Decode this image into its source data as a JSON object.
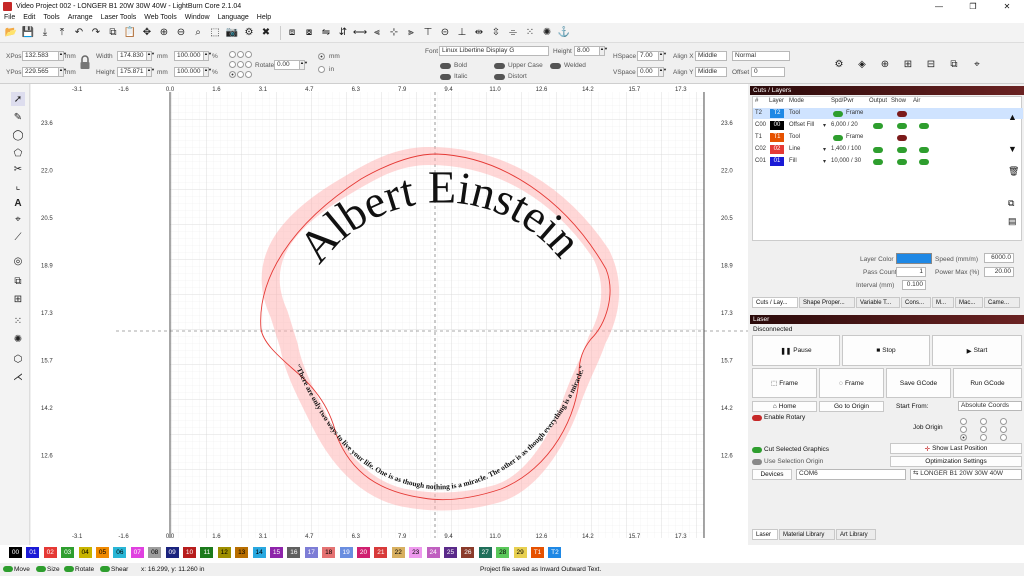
{
  "window": {
    "title": "Video Project 002 - LONGER B1 20W 30W 40W - LightBurn Core 2.1.04",
    "minimize": "—",
    "maximize": "❐",
    "close": "✕"
  },
  "menu": [
    "File",
    "Edit",
    "Tools",
    "Arrange",
    "Laser Tools",
    "Web Tools",
    "Window",
    "Language",
    "Help"
  ],
  "toolbar": {
    "icons": [
      "open-file-icon",
      "save-icon",
      "import-icon",
      "export-icon",
      "undo-icon",
      "redo-icon",
      "copy-icon",
      "paste-icon",
      "move-icon",
      "zoom-in-icon",
      "zoom-out-icon",
      "zoom-frame-icon",
      "select-frame-icon",
      "camera-icon",
      "settings-icon",
      "tools-icon"
    ],
    "icons2": [
      "group-icon",
      "ungroup-icon",
      "flip-h-icon",
      "flip-v-icon",
      "mirror-icon",
      "align-left-icon",
      "align-center-icon",
      "align-right-icon",
      "align-top-icon",
      "align-middle-icon",
      "align-bottom-icon",
      "distribute-h-icon",
      "distribute-v-icon",
      "move-together-icon",
      "grid-array-icon",
      "circular-array-icon",
      "dock-icon"
    ]
  },
  "props": {
    "xpos_label": "XPos",
    "xpos": "132.583",
    "ypos_label": "YPos",
    "ypos": "229.565",
    "unit": "mm",
    "width_label": "Width",
    "width": "174.830",
    "height_label": "Height",
    "height": "175.871",
    "pct_w": "100.000",
    "pct_h": "100.000",
    "pct": "%",
    "rotate_label": "Rotate",
    "rotate": "0.00",
    "unit_mm": "mm",
    "unit_in": "in",
    "font_label": "Font",
    "font": "Linux Libertine Display G",
    "fheight_label": "Height",
    "fheight": "8.00",
    "hspace_label": "HSpace",
    "hspace": "7.00",
    "vspace_label": "VSpace",
    "vspace": "0.00",
    "alignx_label": "Align X",
    "alignx": "Middle",
    "aligny_label": "Align Y",
    "aligny": "Middle",
    "normal": "Normal",
    "offset_label": "Offset",
    "offset": "0",
    "bold": "Bold",
    "italic": "Italic",
    "upper": "Upper Case",
    "distort": "Distort",
    "welded": "Welded"
  },
  "ruler": {
    "x": [
      "-3.1",
      "-1.6",
      "0.0",
      "1.6",
      "3.1",
      "4.7",
      "6.3",
      "7.9",
      "9.4",
      "11.0",
      "12.6",
      "14.2",
      "15.7",
      "17.3"
    ],
    "y": [
      "23.6",
      "22.0",
      "20.5",
      "18.9",
      "17.3",
      "15.7",
      "14.2",
      "12.6"
    ]
  },
  "artwork": {
    "title": "Albert Einstein",
    "quote": "\"There are only two ways to live your life. One is as though nothing is a miracle. The other is as though everything is a miracle.\""
  },
  "cuts": {
    "header": "Cuts / Layers",
    "cols": [
      "#",
      "Layer",
      "Mode",
      "Spd/Pwr",
      "Output",
      "Show",
      "Air"
    ],
    "rows": [
      {
        "num": "T2",
        "layer": "T2",
        "color": "#1e88e5",
        "mode": "Tool",
        "spd": "Frame",
        "has_output": false
      },
      {
        "num": "C00",
        "layer": "00",
        "color": "#000000",
        "mode": "Offset Fill",
        "spd": "6,000 / 20",
        "has_output": true
      },
      {
        "num": "T1",
        "layer": "T1",
        "color": "#e65100",
        "mode": "Tool",
        "spd": "Frame",
        "has_output": false
      },
      {
        "num": "C02",
        "layer": "02",
        "color": "#e53935",
        "mode": "Line",
        "spd": "1,400 / 100",
        "has_output": true
      },
      {
        "num": "C01",
        "layer": "01",
        "color": "#1a1ad6",
        "mode": "Fill",
        "spd": "10,000 / 30",
        "has_output": true
      }
    ],
    "layer_color_label": "Layer Color",
    "speed_label": "Speed (mm/m)",
    "speed": "6000.0",
    "pass_label": "Pass Count",
    "pass": "1",
    "power_label": "Power Max (%)",
    "power": "20.00",
    "interval_label": "Interval (mm)",
    "interval": "0.100",
    "tabs": [
      "Cuts / Lay...",
      "Shape Proper...",
      "Variable T...",
      "Cons...",
      "M...",
      "Mac...",
      "Came..."
    ]
  },
  "laser": {
    "header": "Laser",
    "status": "Disconnected",
    "pause": "Pause",
    "stop": "Stop",
    "start": "Start",
    "frame1": "Frame",
    "frame2": "Frame",
    "save_gcode": "Save GCode",
    "run_gcode": "Run GCode",
    "home": "Home",
    "go_origin": "Go to Origin",
    "start_from_label": "Start From:",
    "start_from": "Absolute Coords",
    "enable_rotary": "Enable Rotary",
    "job_origin": "Job Origin",
    "cut_selected": "Cut Selected Graphics",
    "show_last": "Show Last Position",
    "use_selection": "Use Selection Origin",
    "optimization": "Optimization Settings",
    "devices": "Devices",
    "port": "COM6",
    "device": "LONGER B1 20W 30W 40W",
    "tabs": [
      "Laser",
      "Material Library",
      "Art Library"
    ]
  },
  "palette": [
    {
      "l": "00",
      "c": "#000000",
      "t": "#fff"
    },
    {
      "l": "01",
      "c": "#1a1ad6",
      "t": "#fff"
    },
    {
      "l": "02",
      "c": "#e53935",
      "t": "#fff"
    },
    {
      "l": "03",
      "c": "#2e9e2e",
      "t": "#fff"
    },
    {
      "l": "04",
      "c": "#c8b400",
      "t": "#000"
    },
    {
      "l": "05",
      "c": "#f08a00",
      "t": "#000"
    },
    {
      "l": "06",
      "c": "#29b6d6",
      "t": "#000"
    },
    {
      "l": "07",
      "c": "#e040e0",
      "t": "#fff"
    },
    {
      "l": "08",
      "c": "#9e9e9e",
      "t": "#000"
    },
    {
      "l": "09",
      "c": "#1a237e",
      "t": "#fff"
    },
    {
      "l": "10",
      "c": "#b71c1c",
      "t": "#fff"
    },
    {
      "l": "11",
      "c": "#1b7a1b",
      "t": "#fff"
    },
    {
      "l": "12",
      "c": "#9e8f00",
      "t": "#000"
    },
    {
      "l": "13",
      "c": "#b86e00",
      "t": "#000"
    },
    {
      "l": "14",
      "c": "#29a8e0",
      "t": "#000"
    },
    {
      "l": "15",
      "c": "#8e24aa",
      "t": "#fff"
    },
    {
      "l": "16",
      "c": "#606060",
      "t": "#fff"
    },
    {
      "l": "17",
      "c": "#7d7dd6",
      "t": "#fff"
    },
    {
      "l": "18",
      "c": "#e57373",
      "t": "#000"
    },
    {
      "l": "19",
      "c": "#6a8ee0",
      "t": "#fff"
    },
    {
      "l": "20",
      "c": "#d02070",
      "t": "#fff"
    },
    {
      "l": "21",
      "c": "#d83a3a",
      "t": "#fff"
    },
    {
      "l": "22",
      "c": "#d8b060",
      "t": "#000"
    },
    {
      "l": "23",
      "c": "#ee99ee",
      "t": "#000"
    },
    {
      "l": "24",
      "c": "#c060c0",
      "t": "#fff"
    },
    {
      "l": "25",
      "c": "#5a2a8a",
      "t": "#fff"
    },
    {
      "l": "26",
      "c": "#8a3a2a",
      "t": "#fff"
    },
    {
      "l": "27",
      "c": "#1f6f5a",
      "t": "#fff"
    },
    {
      "l": "28",
      "c": "#5ac85a",
      "t": "#000"
    },
    {
      "l": "29",
      "c": "#e8d050",
      "t": "#000"
    },
    {
      "l": "T1",
      "c": "#e65100",
      "t": "#fff"
    },
    {
      "l": "T2",
      "c": "#1e88e5",
      "t": "#fff"
    }
  ],
  "status": {
    "move": "Move",
    "size": "Size",
    "rotate": "Rotate",
    "shear": "Shear",
    "coords": "x: 16.299, y: 11.260 in",
    "message": "Project file saved as Inward Outward Text."
  }
}
